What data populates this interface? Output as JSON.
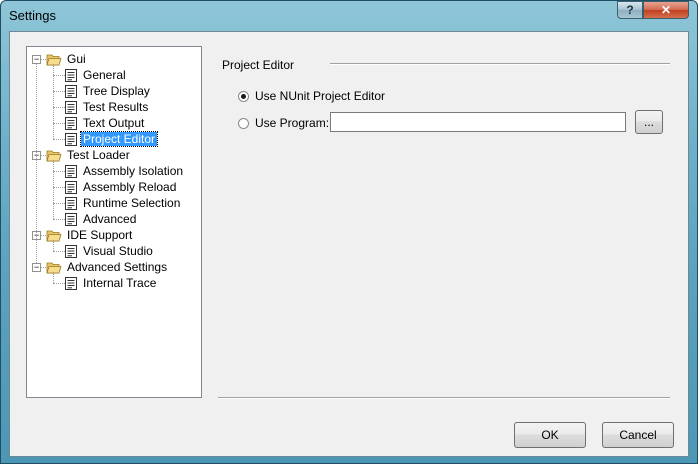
{
  "window": {
    "title": "Settings",
    "help_label": "?",
    "close_label": "✕"
  },
  "tree": {
    "groups": [
      {
        "label": "Gui",
        "items": [
          "General",
          "Tree Display",
          "Test Results",
          "Text Output",
          "Project Editor"
        ]
      },
      {
        "label": "Test Loader",
        "items": [
          "Assembly Isolation",
          "Assembly Reload",
          "Runtime Selection",
          "Advanced"
        ]
      },
      {
        "label": "IDE Support",
        "items": [
          "Visual Studio"
        ]
      },
      {
        "label": "Advanced Settings",
        "items": [
          "Internal Trace"
        ]
      }
    ],
    "selected": "Project Editor",
    "expander_glyph": "−"
  },
  "panel": {
    "title": "Project Editor",
    "option_nunit": "Use NUnit Project Editor",
    "option_program": "Use Program:",
    "program_path": "",
    "browse_label": "..."
  },
  "buttons": {
    "ok": "OK",
    "cancel": "Cancel"
  },
  "colors": {
    "selection": "#3399ff",
    "title_bar": "#6fb0c8",
    "close": "#c0401f"
  }
}
